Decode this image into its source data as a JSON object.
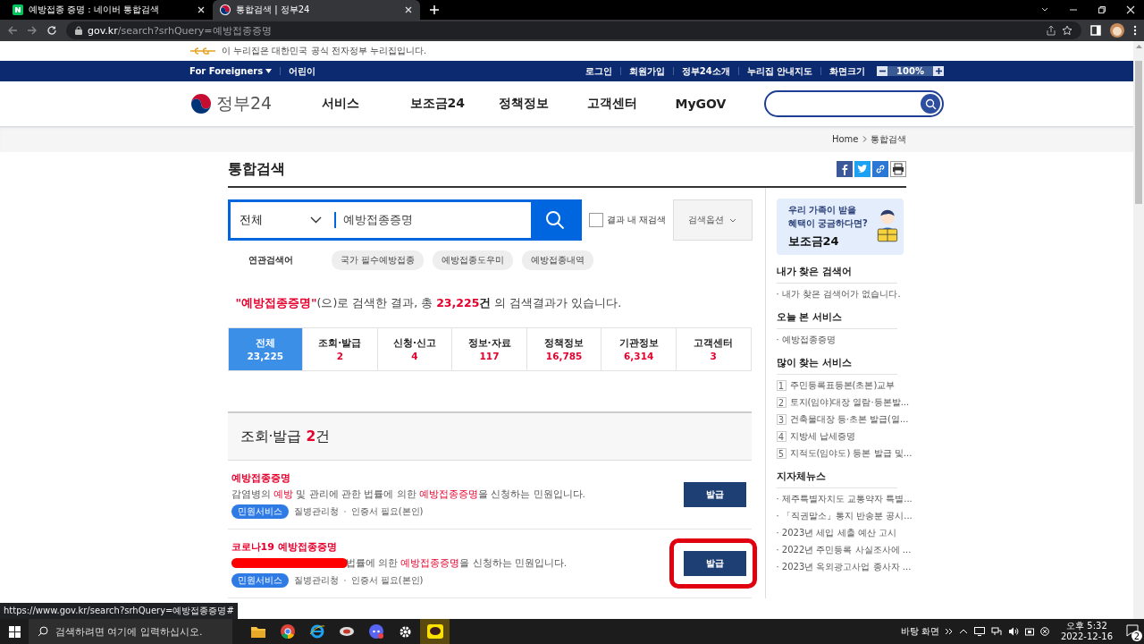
{
  "browser": {
    "tabs": [
      {
        "title": "예방접종 증명 : 네이버 통합검색",
        "kind": "naver",
        "selected": false
      },
      {
        "title": "통합검색 | 정부24",
        "kind": "gov",
        "selected": true
      }
    ],
    "url_host": "gov.kr",
    "url_path": "/search?srhQuery=예방접종증명"
  },
  "notice": "이 누리집은 대한민국 공식 전자정부 누리집입니다.",
  "topbar": {
    "left": [
      "For Foreigners",
      "어린이"
    ],
    "right": [
      "로그인",
      "회원가입",
      "정부24소개",
      "누리집 안내지도",
      "화면크기"
    ],
    "zoom": "100%"
  },
  "header": {
    "logo": "정부24",
    "menu": [
      "서비스",
      "보조금24",
      "정책정보",
      "고객센터",
      "MyGOV"
    ]
  },
  "breadcrumb": [
    "Home",
    "통합검색"
  ],
  "page_title": "통합검색",
  "search": {
    "scope": "전체",
    "value": "예방접종증명",
    "research_label": "결과 내 재검색",
    "research_checked": false,
    "options": "검색옵션"
  },
  "related": {
    "label": "연관검색어",
    "terms": [
      "국가 필수예방접종",
      "예방접종도우미",
      "예방접종내역"
    ]
  },
  "summary": [
    {
      "text": "\"예방접종증명\"",
      "kind": "query"
    },
    {
      "text": "(으)로 검색한 결과, 총 ",
      "kind": "text"
    },
    {
      "text": "23,225",
      "kind": "count"
    },
    {
      "text": "건",
      "kind": "unit"
    },
    {
      "text": " 의 검색결과가 있습니다.",
      "kind": "text"
    }
  ],
  "category_tabs": [
    {
      "label": "전체",
      "count": "23,225",
      "selected": true
    },
    {
      "label": "조회·발급",
      "count": "2",
      "selected": false
    },
    {
      "label": "신청·신고",
      "count": "4",
      "selected": false
    },
    {
      "label": "정보·자료",
      "count": "117",
      "selected": false
    },
    {
      "label": "정책정보",
      "count": "16,785",
      "selected": false
    },
    {
      "label": "기관정보",
      "count": "6,314",
      "selected": false
    },
    {
      "label": "고객센터",
      "count": "3",
      "selected": false
    }
  ],
  "section": {
    "title": "조회·발급",
    "count": "2",
    "unit": "건"
  },
  "results": [
    {
      "title": "예방접종증명",
      "redacted": false,
      "annotated": false,
      "desc": [
        {
          "text": "감염병의 ",
          "kind": "text"
        },
        {
          "text": "예방",
          "kind": "keyword"
        },
        {
          "text": " 및 관리에 관한 법률에 의한 ",
          "kind": "text"
        },
        {
          "text": "예방접종증명",
          "kind": "keyword"
        },
        {
          "text": "을 신청하는 민원입니다.",
          "kind": "text"
        }
      ],
      "tag": "민원서비스",
      "agency": "질병관리청",
      "note": "인증서 필요(본인)",
      "button": "발급"
    },
    {
      "title": "코로나19 예방접종증명",
      "redacted": true,
      "annotated": true,
      "desc": [
        {
          "text": "법률에 의한 ",
          "kind": "text"
        },
        {
          "text": "예방접종증명",
          "kind": "keyword"
        },
        {
          "text": "을 신청하는 민원입니다.",
          "kind": "text"
        }
      ],
      "tag": "민원서비스",
      "agency": "질병관리청",
      "note": "인증서 필요(본인)",
      "button": "발급"
    }
  ],
  "sidebar": {
    "banner": {
      "lines": [
        "우리 가족이 받을",
        "혜택이 궁금하다면?"
      ],
      "title": "보조금24"
    },
    "sections": [
      {
        "title": "내가 찾은 검색어",
        "kind": "bullets",
        "items": [
          "· 내가 찾은 검색어가 없습니다."
        ]
      },
      {
        "title": "오늘 본 서비스",
        "kind": "bullets",
        "items": [
          "· 예방접종증명"
        ]
      },
      {
        "title": "많이 찾는 서비스",
        "kind": "numbered",
        "items": [
          {
            "num": "1",
            "text": "주민등록표등본(초본)교부"
          },
          {
            "num": "2",
            "text": "토지(임야)대장 열람·등본발..."
          },
          {
            "num": "3",
            "text": "건축물대장 등·초본 발급(열..."
          },
          {
            "num": "4",
            "text": "지방세 납세증명"
          },
          {
            "num": "5",
            "text": "지적도(임야도) 등본 발급 및..."
          }
        ]
      },
      {
        "title": "지자체뉴스",
        "kind": "bullets",
        "items": [
          "· 제주특별자치도 교통약자 특별...",
          "· 「직권말소」통지 반송분 공시...",
          "· 2023년 세입 세출 예산 고시",
          "· 2022년 주민등록 사실조사에 ...",
          "· 2023년 옥외광고사업 종사자 ..."
        ]
      }
    ]
  },
  "status_url": "https://www.gov.kr/search?srhQuery=예방접종증명#",
  "taskbar": {
    "search_placeholder": "검색하려면 여기에 입력하십시오.",
    "desktop": "바탕 화면",
    "time": "오후 5:32",
    "date": "2022-12-16",
    "notifications": "2"
  }
}
